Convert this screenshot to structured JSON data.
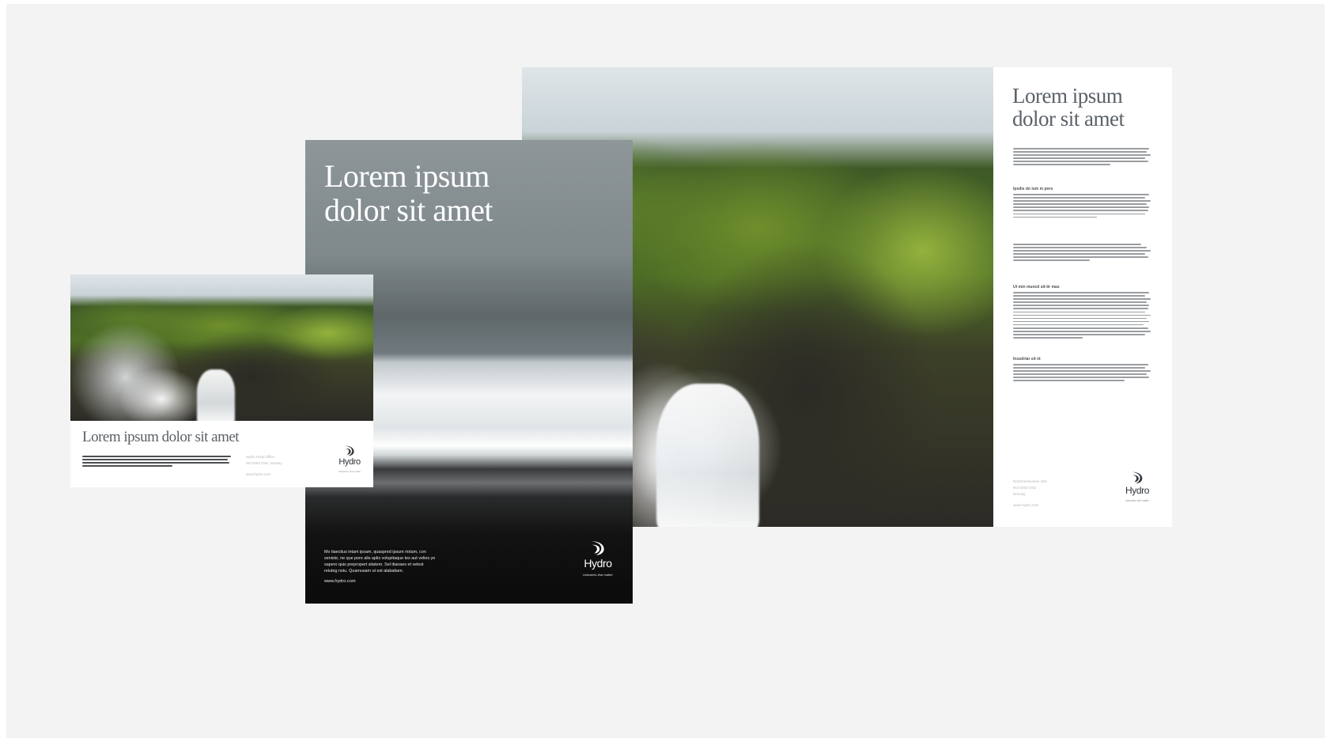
{
  "brochure": {
    "title_line1": "Lorem ipsum",
    "title_line2": "dolor sit amet",
    "heading_1": "Ipsdis do ium m pors",
    "heading_2": "Ut min muncd sit-tir mas",
    "heading_3": "Inusdriar sit nt",
    "address_1": "Drammensveien 260",
    "address_2": "NO-0283 Oslo",
    "address_3": "Norway",
    "web": "www.hydro.com"
  },
  "poster": {
    "title_line1": "Lorem ipsum",
    "title_line2": "dolor sit amet",
    "body_line1": "Mo tiaectius intam ipsam, quaspred ipsum riotam, con",
    "body_line2": "seniste, ne que pore alis aplis volupitaque tes aut velies ye",
    "body_line3": "sapero quis prepropert sitatem. Sel itianaes et velest",
    "body_line4": "reiuteg nstu. Quamusam ut est alabatiam.",
    "web": "www.hydro.com"
  },
  "postcard": {
    "title": "Lorem ipsum dolor sit amet",
    "address_1": "Hydro Head Office",
    "address_2": "NO-0283 Oslo, Norway",
    "web": "www.hydro.com"
  },
  "logo": {
    "wordmark": "Hydro",
    "tagline": "Industries that matter"
  },
  "colors": {
    "background": "#f3f3f3",
    "title_gray": "#5b6168",
    "poster_title": "#ffffff"
  }
}
